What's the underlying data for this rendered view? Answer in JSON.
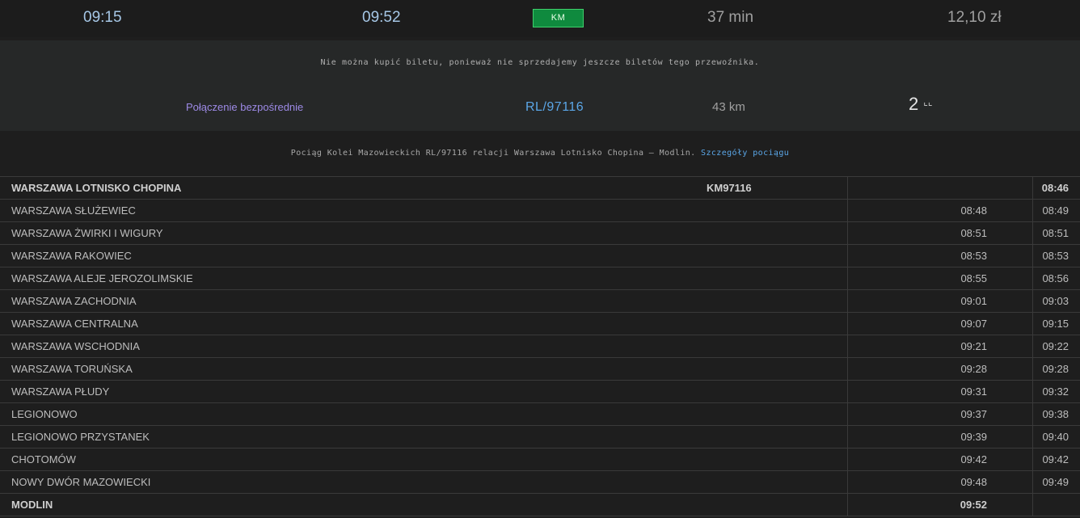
{
  "summary": {
    "departure": "09:15",
    "arrival": "09:52",
    "carrier_badge": "KM",
    "duration": "37 min",
    "price": "12,10 zł"
  },
  "panel": {
    "notice": "Nie można kupić biletu, ponieważ nie sprzedajemy jeszcze biletów tego przewoźnika.",
    "direct_label": "Połączenie bezpośrednie",
    "train_number": "RL/97116",
    "distance": "43 km",
    "class": "2",
    "seat_icon": "seat-icon",
    "colors": {
      "badge": "#0f8a3e",
      "link": "#5ba7e8",
      "direct": "#9d8ae6"
    }
  },
  "info": {
    "text": "Pociąg Kolei Mazowieckich RL/97116 relacji Warszawa Lotnisko Chopina — Modlin.",
    "link": "Szczegóły pociągu"
  },
  "stops": [
    {
      "station": "WARSZAWA LOTNISKO CHOPINA",
      "code": "KM97116",
      "arr": "",
      "dep": "08:46",
      "bold": true
    },
    {
      "station": "WARSZAWA SŁUŻEWIEC",
      "code": "",
      "arr": "08:48",
      "dep": "08:49",
      "bold": false
    },
    {
      "station": "WARSZAWA ŻWIRKI I WIGURY",
      "code": "",
      "arr": "08:51",
      "dep": "08:51",
      "bold": false
    },
    {
      "station": "WARSZAWA RAKOWIEC",
      "code": "",
      "arr": "08:53",
      "dep": "08:53",
      "bold": false
    },
    {
      "station": "WARSZAWA ALEJE JEROZOLIMSKIE",
      "code": "",
      "arr": "08:55",
      "dep": "08:56",
      "bold": false
    },
    {
      "station": "WARSZAWA ZACHODNIA",
      "code": "",
      "arr": "09:01",
      "dep": "09:03",
      "bold": false
    },
    {
      "station": "WARSZAWA CENTRALNA",
      "code": "",
      "arr": "09:07",
      "dep": "09:15",
      "bold": false
    },
    {
      "station": "WARSZAWA WSCHODNIA",
      "code": "",
      "arr": "09:21",
      "dep": "09:22",
      "bold": false
    },
    {
      "station": "WARSZAWA TORUŃSKA",
      "code": "",
      "arr": "09:28",
      "dep": "09:28",
      "bold": false
    },
    {
      "station": "WARSZAWA PŁUDY",
      "code": "",
      "arr": "09:31",
      "dep": "09:32",
      "bold": false
    },
    {
      "station": "LEGIONOWO",
      "code": "",
      "arr": "09:37",
      "dep": "09:38",
      "bold": false
    },
    {
      "station": "LEGIONOWO PRZYSTANEK",
      "code": "",
      "arr": "09:39",
      "dep": "09:40",
      "bold": false
    },
    {
      "station": "CHOTOMÓW",
      "code": "",
      "arr": "09:42",
      "dep": "09:42",
      "bold": false
    },
    {
      "station": "NOWY DWÓR MAZOWIECKI",
      "code": "",
      "arr": "09:48",
      "dep": "09:49",
      "bold": false
    },
    {
      "station": "MODLIN",
      "code": "",
      "arr": "09:52",
      "dep": "",
      "bold": true
    }
  ]
}
